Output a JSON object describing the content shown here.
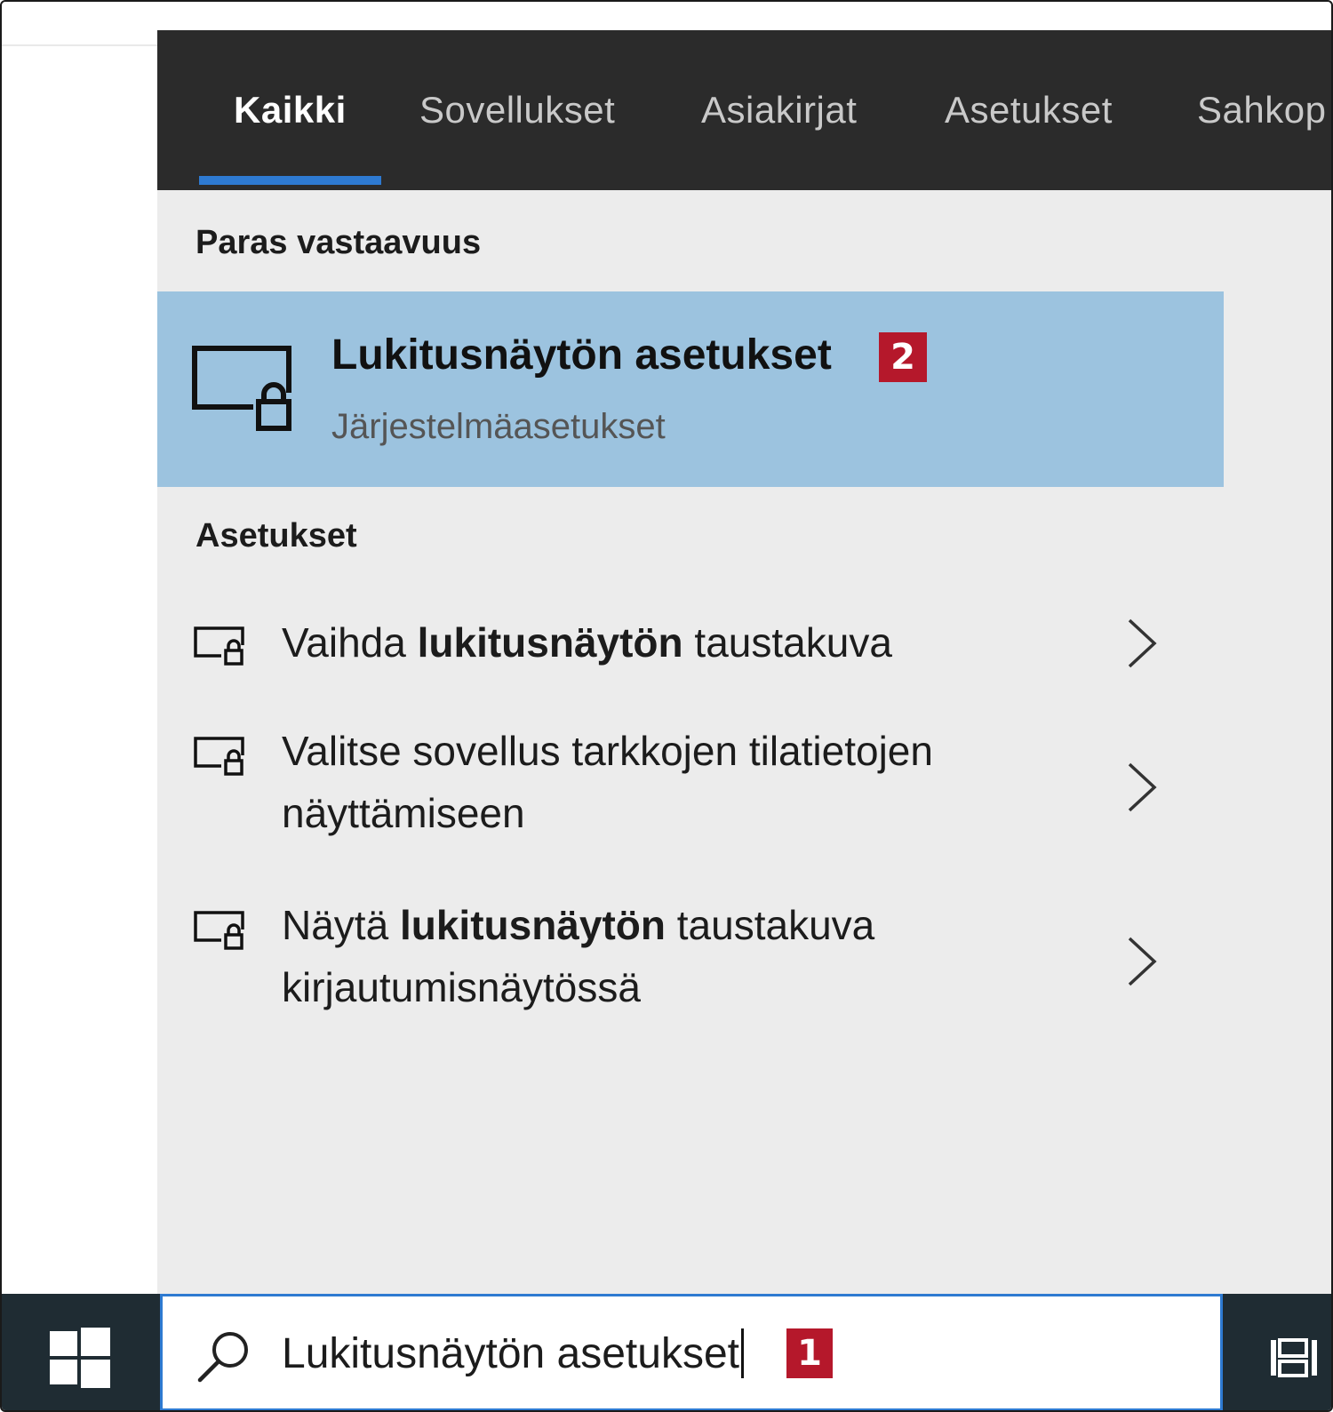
{
  "tabs": [
    {
      "label": "Kaikki",
      "active": true
    },
    {
      "label": "Sovellukset",
      "active": false
    },
    {
      "label": "Asiakirjat",
      "active": false
    },
    {
      "label": "Asetukset",
      "active": false
    },
    {
      "label": "Sahkop",
      "active": false
    }
  ],
  "best_match": {
    "section_title": "Paras vastaavuus",
    "title": "Lukitusnäytön asetukset",
    "subtitle": "Järjestelmäasetukset",
    "badge": "2",
    "icon": "lock-screen-icon"
  },
  "settings_section": {
    "title": "Asetukset",
    "items": [
      {
        "pre": "Vaihda ",
        "bold": "lukitusnäytön",
        "post": " taustakuva",
        "icon": "lock-screen-icon"
      },
      {
        "pre": "Valitse sovellus tarkkojen tilatietojen näyttämiseen",
        "bold": "",
        "post": "",
        "icon": "lock-screen-icon"
      },
      {
        "pre": "Näytä ",
        "bold": "lukitusnäytön",
        "post": " taustakuva kirjautumisnäytössä",
        "icon": "lock-screen-icon"
      }
    ]
  },
  "taskbar": {
    "search_value": "Lukitusnäytön asetukset",
    "badge": "1",
    "start_icon": "windows-start-icon",
    "search_icon": "search-icon",
    "taskview_icon": "task-view-icon"
  },
  "colors": {
    "tabbar": "#2b2b2b",
    "accent": "#2e7ad1",
    "highlight": "#9cc3df",
    "panel": "#ececec",
    "taskbar": "#1f2c33",
    "badge": "#b5182b"
  }
}
